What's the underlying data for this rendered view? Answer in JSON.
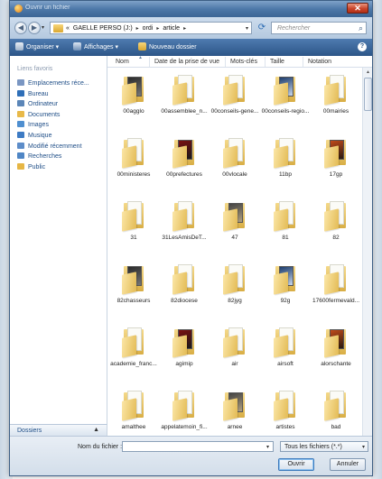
{
  "window": {
    "title": "Ouvrir un fichier"
  },
  "nav": {
    "breadcrumbs": [
      "«",
      "GAELLE PERSO (J:)",
      "ordi",
      "article"
    ],
    "search_placeholder": "Rechercher"
  },
  "toolbar": {
    "organize": "Organiser",
    "views": "Affichages",
    "new_folder": "Nouveau dossier"
  },
  "sidebar": {
    "title": "Liens favoris",
    "items": [
      {
        "label": "Emplacements réce...",
        "icon": "recent-places-icon",
        "color": "#7a96c2"
      },
      {
        "label": "Bureau",
        "icon": "desktop-icon",
        "color": "#2f6fb8"
      },
      {
        "label": "Ordinateur",
        "icon": "computer-icon",
        "color": "#5b86b8"
      },
      {
        "label": "Documents",
        "icon": "documents-icon",
        "color": "#e8b949"
      },
      {
        "label": "Images",
        "icon": "images-icon",
        "color": "#4f8fd0"
      },
      {
        "label": "Musique",
        "icon": "music-icon",
        "color": "#3d7bc4"
      },
      {
        "label": "Modifié récemment",
        "icon": "recent-changes-icon",
        "color": "#5d8dc9"
      },
      {
        "label": "Recherches",
        "icon": "searches-icon",
        "color": "#4f86c5"
      },
      {
        "label": "Public",
        "icon": "public-folder-icon",
        "color": "#e6b645"
      }
    ],
    "folders_label": "Dossiers"
  },
  "columns": [
    "Nom",
    "Date de la prise de vue",
    "Mots-clés",
    "Taille",
    "Notation"
  ],
  "files": [
    "00agglo",
    "00assemblee_n...",
    "00conseils-gene...",
    "00conseils-regio...",
    "00mairies",
    "00ministeres",
    "00prefectures",
    "00vlocale",
    "11bp",
    "17gp",
    "31",
    "31LesAmisDeT...",
    "47",
    "81",
    "82",
    "82chasseurs",
    "82diocese",
    "82jyg",
    "92g",
    "17600fermevald...",
    "academie_franc...",
    "agimip",
    "air",
    "airsoft",
    "alorschante",
    "amalthee",
    "appelatemoin_fi...",
    "arnee",
    "artistes",
    "bad"
  ],
  "footer": {
    "filename_label": "Nom du fichier :",
    "filename_value": "",
    "filetype": "Tous les fichiers (*.*)",
    "open_button": "Ouvrir",
    "cancel_button": "Annuler"
  }
}
